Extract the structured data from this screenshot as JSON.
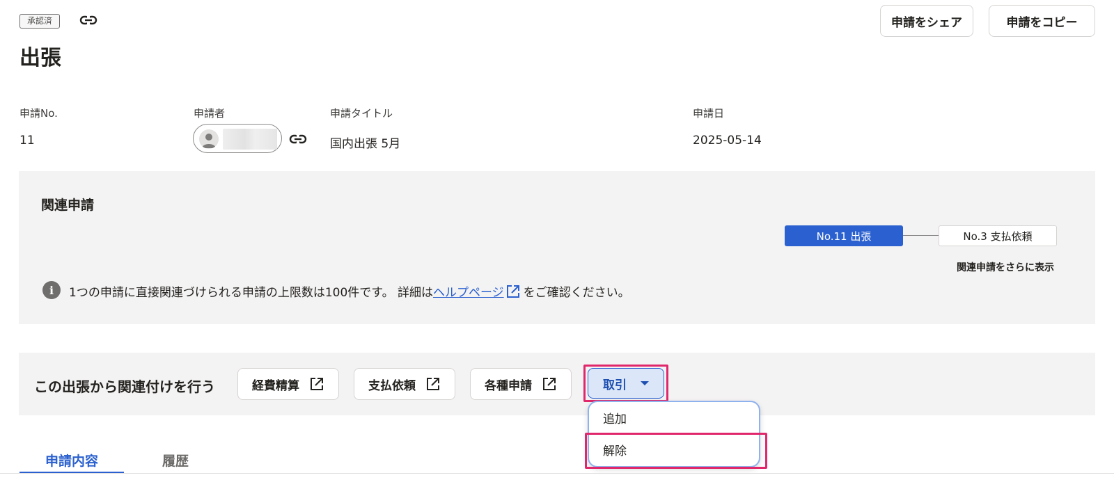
{
  "header": {
    "status_badge": "承認済",
    "title": "出張",
    "share_button": "申請をシェア",
    "copy_button": "申請をコピー"
  },
  "fields": {
    "number_label": "申請No.",
    "number_value": "11",
    "applicant_label": "申請者",
    "title_label": "申請タイトル",
    "title_value": "国内出張 5月",
    "date_label": "申請日",
    "date_value": "2025-05-14"
  },
  "related": {
    "heading": "関連申請",
    "current_node": "No.11 出張",
    "linked_node": "No.3 支払依頼",
    "show_more": "関連申請をさらに表示",
    "info_prefix": "1つの申請に直接関連づけられる申請の上限数は100件です。 詳細は",
    "help_link": "ヘルプページ",
    "info_suffix": "をご確認ください。"
  },
  "actions": {
    "label": "この出張から関連付けを行う",
    "expense": "経費精算",
    "payment": "支払依頼",
    "various": "各種申請",
    "deal": "取引"
  },
  "dropdown": {
    "add": "追加",
    "remove": "解除"
  },
  "tabs": {
    "content": "申請内容",
    "history": "履歴"
  },
  "colors": {
    "accent": "#2a60cf",
    "highlight": "#e0276b"
  }
}
